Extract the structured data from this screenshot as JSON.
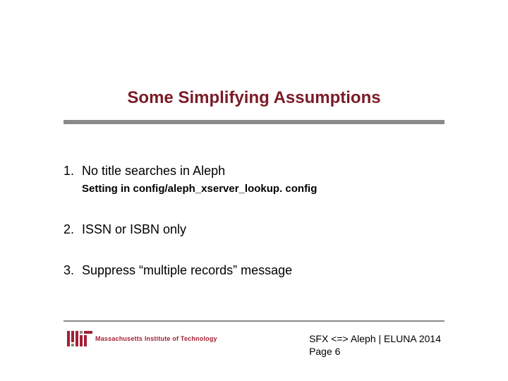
{
  "title": "Some Simplifying Assumptions",
  "items": [
    {
      "num": "1.",
      "text": "No title searches in Aleph",
      "sub": "Setting in config/aleph_xserver_lookup. config"
    },
    {
      "num": "2.",
      "text": "ISSN or ISBN only",
      "sub": ""
    },
    {
      "num": "3.",
      "text": "Suppress “multiple records” message",
      "sub": ""
    }
  ],
  "logo_text": "Massachusetts Institute of Technology",
  "footer_line1": "SFX <=> Aleph | ELUNA 2014",
  "footer_line2": "Page 6"
}
